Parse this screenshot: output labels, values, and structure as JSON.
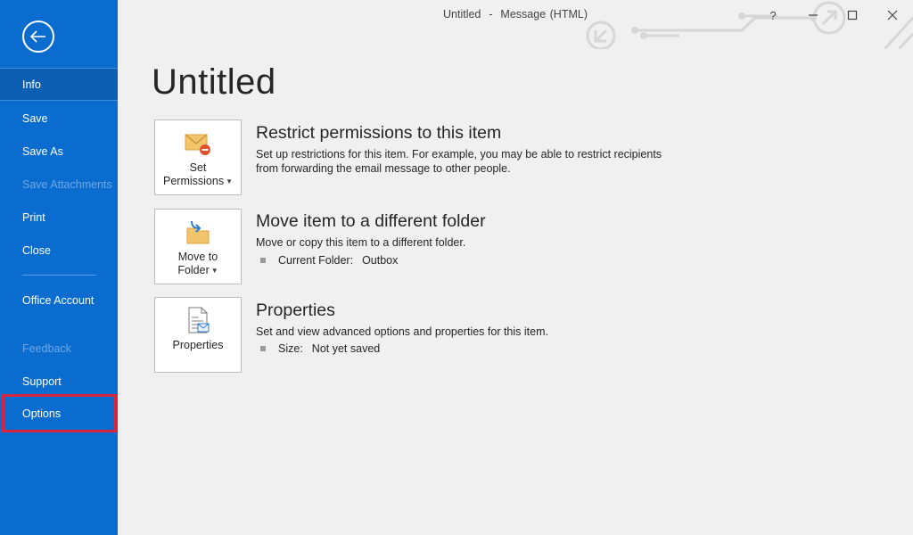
{
  "window": {
    "title": "Untitled  -  Message (HTML)",
    "help": "?"
  },
  "sidebar": {
    "items": [
      {
        "label": "Info",
        "state": "selected"
      },
      {
        "label": "Save",
        "state": "normal"
      },
      {
        "label": "Save As",
        "state": "normal"
      },
      {
        "label": "Save Attachments",
        "state": "disabled"
      },
      {
        "label": "Print",
        "state": "normal"
      },
      {
        "label": "Close",
        "state": "normal"
      },
      {
        "label": "Office Account",
        "state": "normal"
      },
      {
        "label": "Feedback",
        "state": "disabled"
      },
      {
        "label": "Support",
        "state": "normal"
      },
      {
        "label": "Options",
        "state": "highlighted"
      }
    ]
  },
  "page": {
    "title": "Untitled"
  },
  "sections": [
    {
      "tile_line1": "Set",
      "tile_line2": "Permissions",
      "tile_icon": "envelope-restrict-icon",
      "heading": "Restrict permissions to this item",
      "description": "Set up restrictions for this item. For example, you may be able to restrict recipients from forwarding the email message to other people."
    },
    {
      "tile_line1": "Move to",
      "tile_line2": "Folder",
      "tile_icon": "move-to-folder-icon",
      "heading": "Move item to a different folder",
      "description": "Move or copy this item to a different folder.",
      "detail_label": "Current Folder:",
      "detail_value": "Outbox"
    },
    {
      "tile_line1": "Properties",
      "tile_icon": "properties-icon",
      "heading": "Properties",
      "description": "Set and view advanced options and properties for this item.",
      "detail_label": "Size:",
      "detail_value": "Not yet saved"
    }
  ],
  "colors": {
    "sidebar_bg": "#0a6ccf",
    "sidebar_selected": "#0c5fb3",
    "highlight_outline": "#d7263d",
    "content_bg": "#f0f0f0"
  }
}
